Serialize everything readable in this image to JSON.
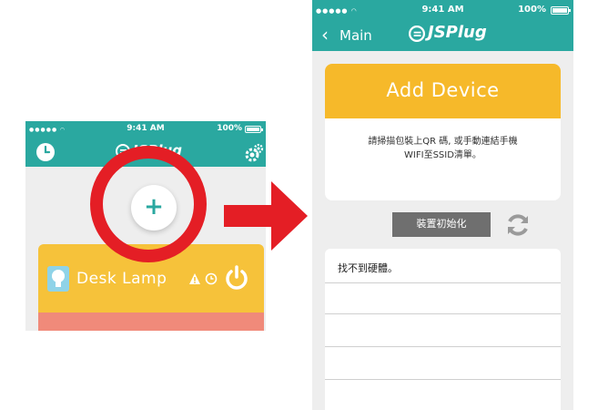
{
  "left_screen": {
    "status": {
      "time": "9:41 AM",
      "battery": "100%"
    },
    "header": {
      "logo": "JSPlug",
      "left_icon": "clock-icon",
      "right_icon": "gear-icon"
    },
    "add_button": {
      "label": "+"
    },
    "device_card": {
      "name": "Desk Lamp",
      "icons": [
        "lamp-icon",
        "warning-icon",
        "timer-icon",
        "power-icon"
      ]
    }
  },
  "right_screen": {
    "status": {
      "time": "9:41 AM",
      "battery": "100%"
    },
    "header": {
      "back_label": "Main",
      "logo": "JSPlug"
    },
    "add_device": {
      "title": "Add Device",
      "instructions_line1": "請掃描包裝上QR 碼, 或手動連結手機",
      "instructions_line2": "WIFI至SSID清單。"
    },
    "reset_button": "裝置初始化",
    "refresh_icon": "refresh-icon",
    "list": {
      "rows": [
        "找不到硬體。",
        "",
        "",
        ""
      ]
    }
  },
  "colors": {
    "teal": "#2aa8a0",
    "yellow": "#f6b92a",
    "red": "#e41e25",
    "salmon": "#f08a7a",
    "button_gray": "#6f6f6f"
  }
}
